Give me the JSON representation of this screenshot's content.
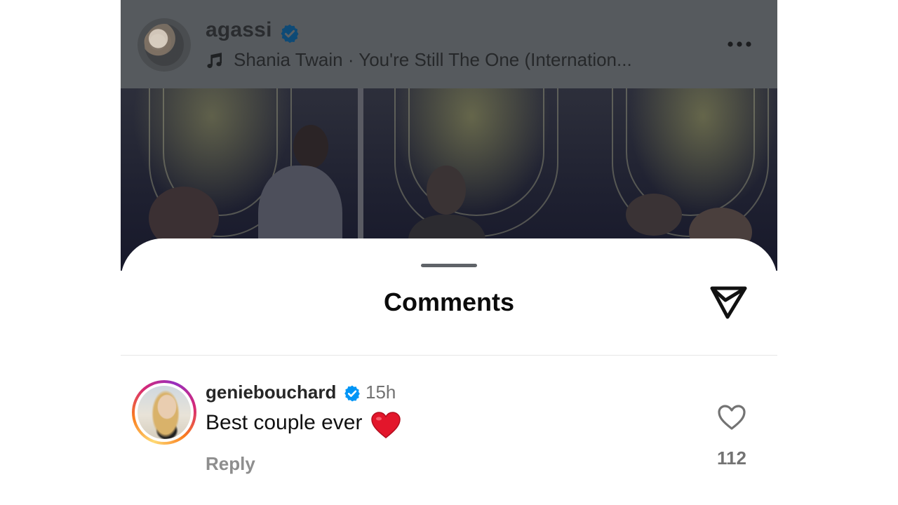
{
  "post": {
    "username": "agassi",
    "verified": true,
    "music": "Shania Twain · You're Still The One (Internation...",
    "more_icon": "more-horizontal-icon"
  },
  "comments_sheet": {
    "title": "Comments",
    "share_icon": "send-icon"
  },
  "comments": [
    {
      "username": "geniebouchard",
      "verified": true,
      "time": "15h",
      "text": "Best couple ever",
      "emoji": "red-heart-emoji",
      "reply_label": "Reply",
      "like_count": "112",
      "like_icon": "heart-outline-icon"
    }
  ],
  "colors": {
    "verified_blue": "#0095f6",
    "overlay_dim": "#565a5e",
    "secondary_text": "#737373"
  }
}
